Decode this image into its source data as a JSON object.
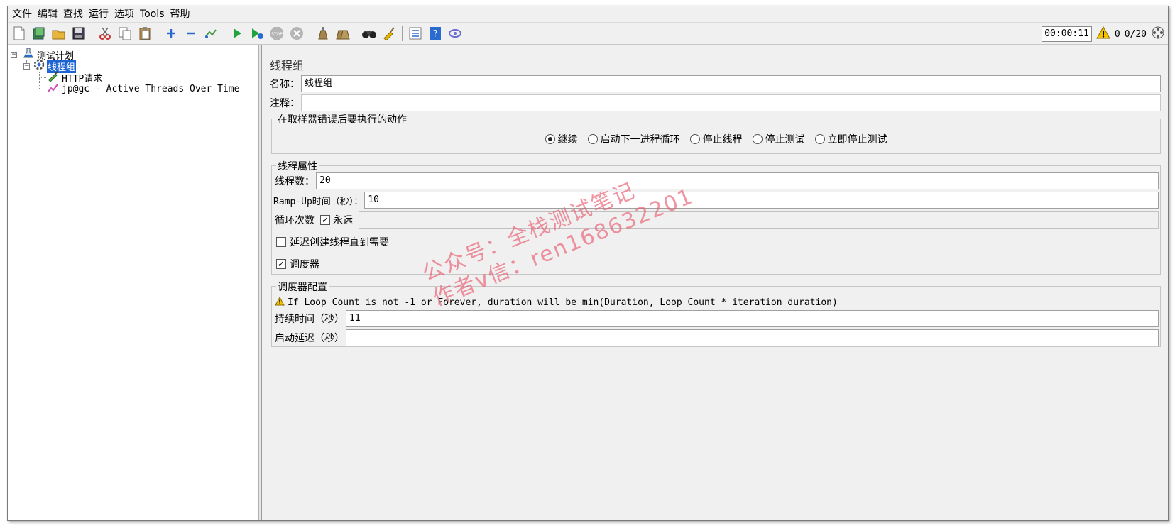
{
  "menu": [
    "文件",
    "编辑",
    "查找",
    "运行",
    "选项",
    "Tools",
    "帮助"
  ],
  "toolbar": {
    "icons": [
      "new-icon",
      "templates-icon",
      "open-icon",
      "save-icon",
      "cut-icon",
      "copy-icon",
      "paste-icon",
      "expand-icon",
      "collapse-icon",
      "toggle-icon",
      "start-icon",
      "start-no-pause-icon",
      "stop-icon",
      "shutdown-icon",
      "clear-icon",
      "clear-all-icon",
      "search-icon",
      "reset-search-icon",
      "function-helper-icon",
      "help-icon",
      "remote-icon"
    ],
    "timer": "00:00:11",
    "warning_count": "0",
    "threads": "0/20"
  },
  "tree": {
    "root": "测试计划",
    "thread_group": "线程组",
    "http_request": "HTTP请求",
    "listener": "jp@gc - Active Threads Over Time"
  },
  "panel": {
    "title": "线程组",
    "name_label": "名称：",
    "name_value": "线程组",
    "comment_label": "注释：",
    "comment_value": "",
    "error_group": {
      "title": "在取样器错误后要执行的动作",
      "options": [
        "继续",
        "启动下一进程循环",
        "停止线程",
        "停止测试",
        "立即停止测试"
      ],
      "selected": "继续"
    },
    "thread_props": {
      "title": "线程属性",
      "threads_label": "线程数：",
      "threads_value": "20",
      "rampup_label": "Ramp-Up时间（秒）：",
      "rampup_value": "10",
      "loop_label": "循环次数",
      "forever_label": "永远",
      "forever_checked": true,
      "loop_value": "",
      "delay_label": "延迟创建线程直到需要",
      "delay_checked": false,
      "scheduler_label": "调度器",
      "scheduler_checked": true
    },
    "scheduler": {
      "title": "调度器配置",
      "warning": "If Loop Count is not -1 or Forever, duration will be min(Duration, Loop Count * iteration duration)",
      "duration_label": "持续时间（秒）",
      "duration_value": "11",
      "delay_label": "启动延迟（秒）",
      "delay_value": ""
    }
  },
  "watermark": {
    "line1": "公众号：全栈测试笔记",
    "line2": "作者v信：ren168632201"
  }
}
